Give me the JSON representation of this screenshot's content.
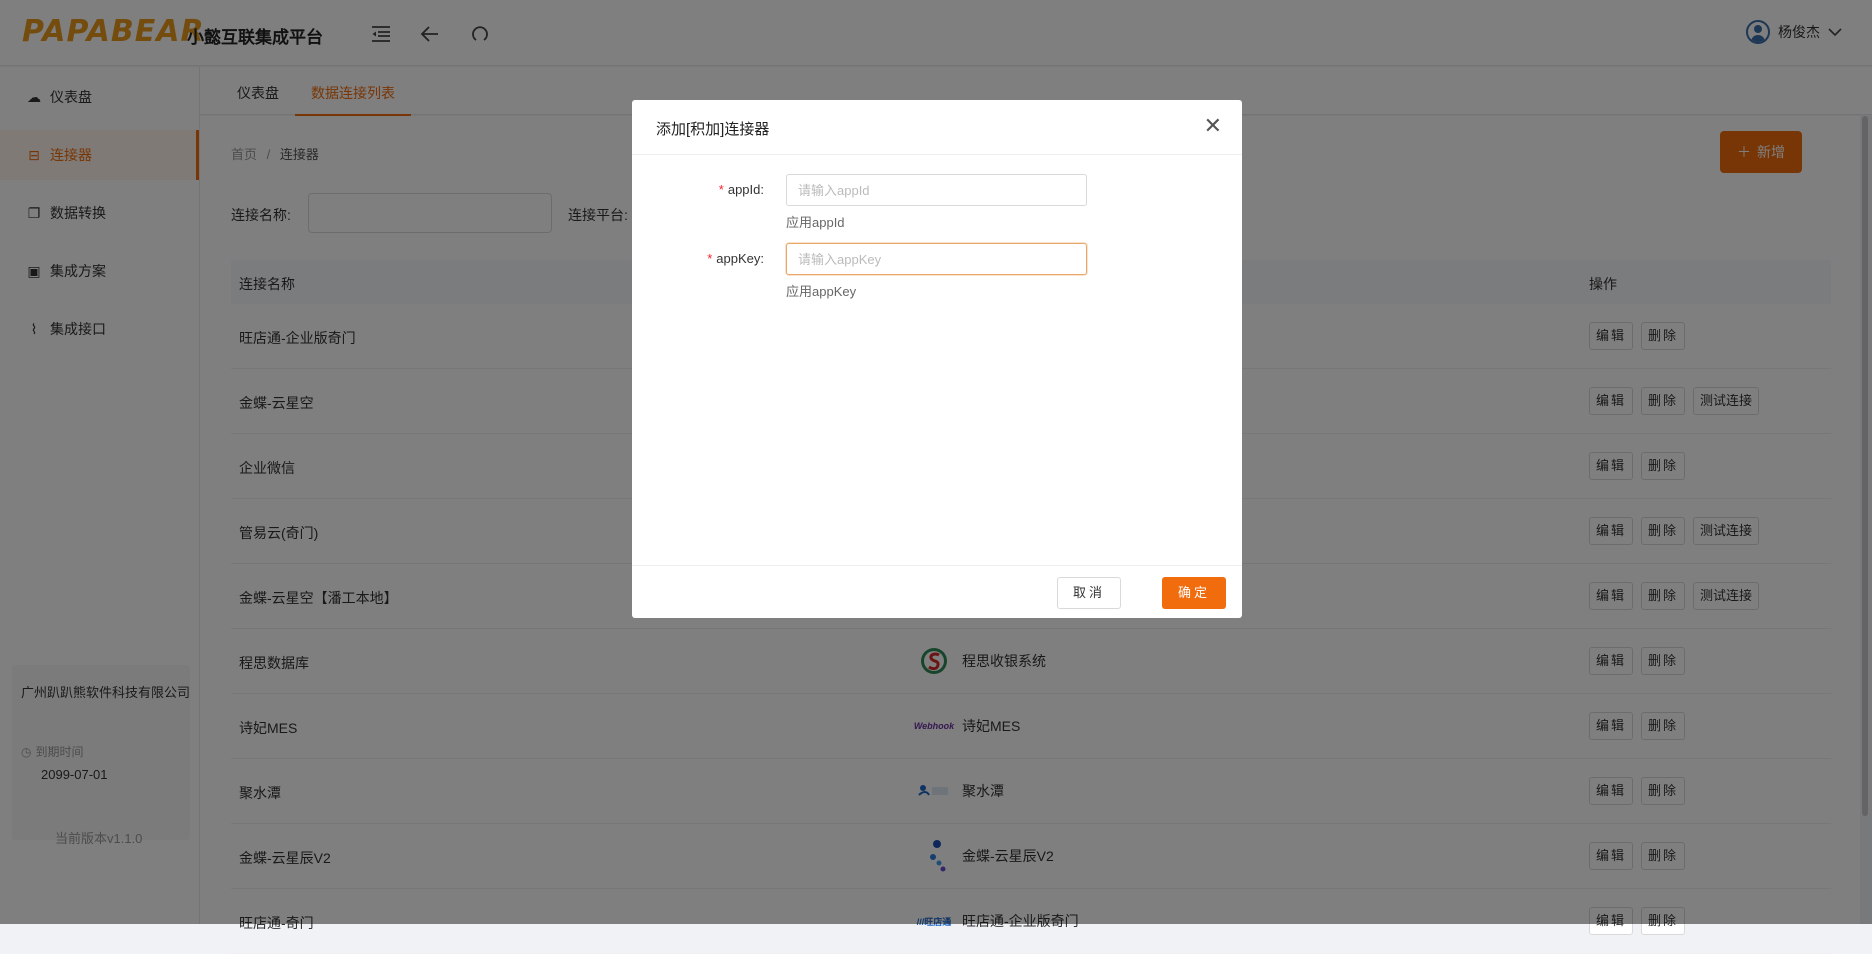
{
  "header": {
    "logo": "PAPABEAR",
    "brand": "小懿互联集成平台",
    "user_name": "杨俊杰"
  },
  "sidebar": {
    "items": [
      {
        "label": "仪表盘",
        "icon": "dashboard-icon"
      },
      {
        "label": "连接器",
        "icon": "connector-icon"
      },
      {
        "label": "数据转换",
        "icon": "transform-icon"
      },
      {
        "label": "集成方案",
        "icon": "scheme-icon"
      },
      {
        "label": "集成接口",
        "icon": "link-icon"
      }
    ],
    "company": "广州趴趴熊软件科技有限公司",
    "expire_label": "到期时间",
    "expire_date": "2099-07-01",
    "version": "当前版本v1.1.0"
  },
  "tabs": [
    "仪表盘",
    "数据连接列表"
  ],
  "breadcrumb": {
    "home": "首页",
    "sep": "/",
    "current": "连接器"
  },
  "add_button": "新增",
  "filters": {
    "name_label": "连接名称:",
    "platform_label": "连接平台:"
  },
  "table": {
    "headers": {
      "name": "连接名称",
      "ops": "操作"
    },
    "rows": [
      {
        "name": "旺店通-企业版奇门",
        "platform": "",
        "test": false
      },
      {
        "name": "金蝶-云星空",
        "platform": "",
        "test": true
      },
      {
        "name": "企业微信",
        "platform": "",
        "test": false
      },
      {
        "name": "管易云(奇门)",
        "platform": "",
        "test": true
      },
      {
        "name": "金蝶-云星空【潘工本地】",
        "platform": "",
        "test": true
      },
      {
        "name": "程思数据库",
        "platform": "程思收银系统",
        "test": false
      },
      {
        "name": "诗妃MES",
        "platform": "诗妃MES",
        "test": false
      },
      {
        "name": "聚水潭",
        "platform": "聚水潭",
        "test": false
      },
      {
        "name": "金蝶-云星辰V2",
        "platform": "金蝶-云星辰V2",
        "test": false
      },
      {
        "name": "旺店通-奇门",
        "platform": "旺店通-企业版奇门",
        "test": false
      }
    ],
    "edit_label": "编辑",
    "delete_label": "删除",
    "test_label": "测试连接"
  },
  "modal": {
    "title": "添加[积加]连接器",
    "fields": [
      {
        "label": "appId:",
        "placeholder": "请输入appId",
        "help": "应用appId"
      },
      {
        "label": "appKey:",
        "placeholder": "请输入appKey",
        "help": "应用appKey"
      }
    ],
    "cancel": "取消",
    "ok": "确定"
  },
  "colors": {
    "accent": "#f06c0d",
    "logo": "#e89a1c"
  }
}
